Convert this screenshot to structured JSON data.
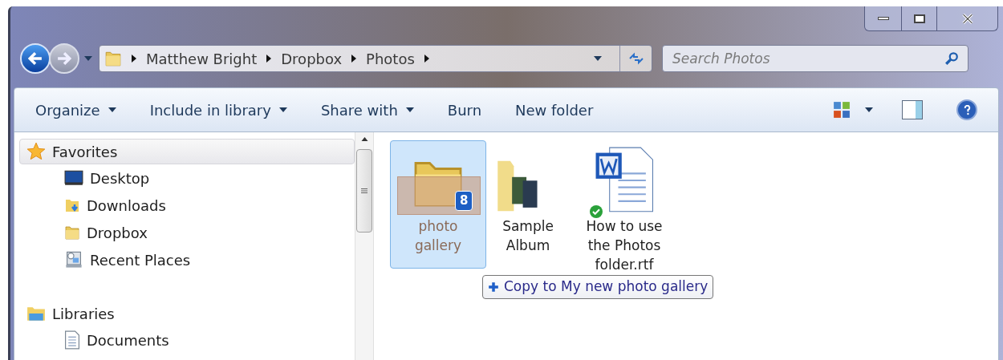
{
  "address": {
    "segments": [
      "Matthew Bright",
      "Dropbox",
      "Photos"
    ]
  },
  "search": {
    "placeholder": "Search Photos"
  },
  "toolbar": [
    {
      "label": "Organize",
      "dropdown": true
    },
    {
      "label": "Include in library",
      "dropdown": true
    },
    {
      "label": "Share with",
      "dropdown": true
    },
    {
      "label": "Burn",
      "dropdown": false
    },
    {
      "label": "New folder",
      "dropdown": false
    }
  ],
  "sidebar": [
    {
      "label": "Favorites",
      "kind": "favorites",
      "selected": true,
      "children": [
        {
          "label": "Desktop",
          "kind": "desktop"
        },
        {
          "label": "Downloads",
          "kind": "downloads"
        },
        {
          "label": "Dropbox",
          "kind": "folder"
        },
        {
          "label": "Recent Places",
          "kind": "recent"
        }
      ]
    },
    {
      "label": "Libraries",
      "kind": "libraries",
      "selected": false,
      "children": [
        {
          "label": "Documents",
          "kind": "documents"
        }
      ]
    }
  ],
  "files": [
    {
      "kind": "folder",
      "label": "photo gallery",
      "selected": true,
      "drag_count": "8"
    },
    {
      "kind": "album",
      "label": "Sample Album",
      "selected": false
    },
    {
      "kind": "word",
      "label": "How to use the Photos folder.rtf",
      "selected": false,
      "synced": true
    }
  ],
  "drag_tip": {
    "text": "Copy to My new photo gallery"
  }
}
